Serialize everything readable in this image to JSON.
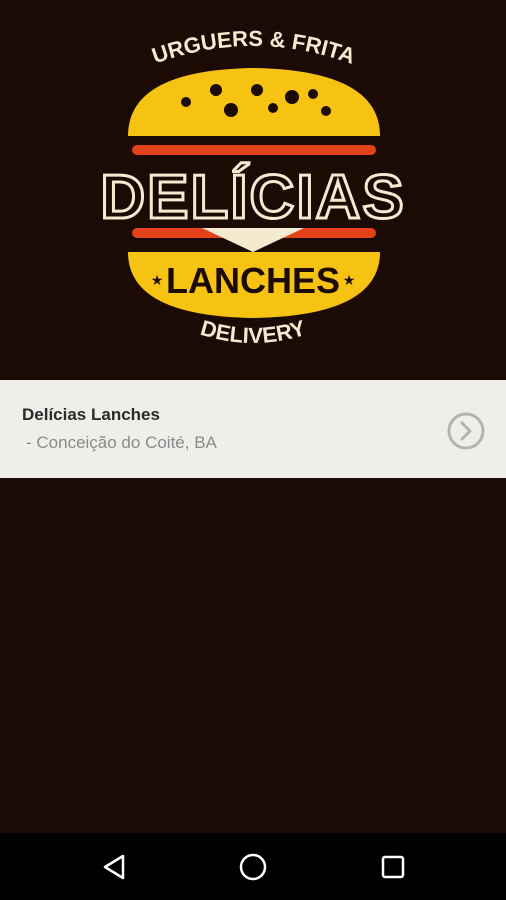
{
  "logo": {
    "top_text": "BURGUERS & FRITAS",
    "main_text": "DELÍCIAS",
    "bottom_text": "LANCHES",
    "footer_text": "DELIVERY",
    "colors": {
      "bun": "#f7c313",
      "accent_red": "#e2421a",
      "cream": "#f3ead0",
      "dark": "#1c0a05"
    }
  },
  "store": {
    "name": "Delícias Lanches",
    "location": " - Conceição do Coité, BA",
    "arrow_icon": "chevron-right-circle-icon"
  },
  "nav": {
    "back_icon": "back-triangle-icon",
    "home_icon": "home-circle-icon",
    "recents_icon": "recents-square-icon"
  }
}
